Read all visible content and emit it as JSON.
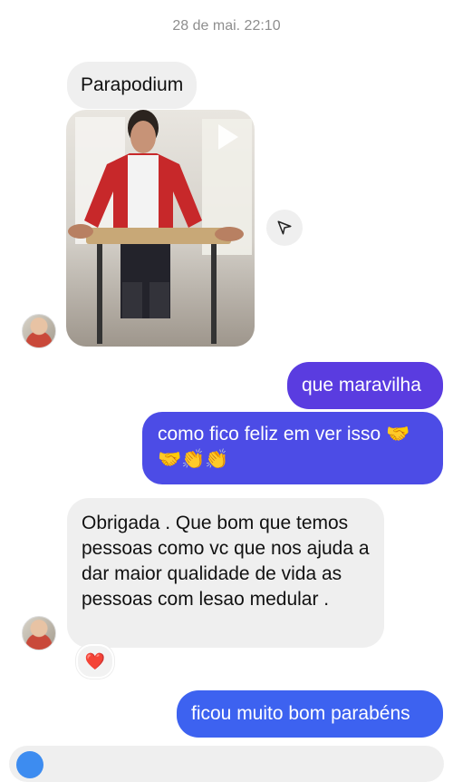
{
  "header": {
    "timestamp": "28 de mai. 22:10"
  },
  "messages": [
    {
      "side": "incoming",
      "text": "Parapodium"
    },
    {
      "side": "incoming",
      "type": "video",
      "media_label": "video-thumbnail"
    },
    {
      "side": "outgoing",
      "text": "que maravilha"
    },
    {
      "side": "outgoing",
      "text_line1": "como fico feliz em ver isso 🤝",
      "text_line2": "🤝👏👏"
    },
    {
      "side": "incoming",
      "text": "Obrigada . Que bom que temos pessoas como vc que nos ajuda a dar maior qualidade de vida as pessoas com lesao medular .",
      "reaction": "❤️"
    },
    {
      "side": "outgoing",
      "text": "ficou muito bom parabéns"
    }
  ],
  "colors": {
    "incoming_bubble": "#efefef",
    "outgoing_purple": "#5a3ce0",
    "outgoing_indigo": "#4c4ce6",
    "outgoing_blue": "#3d62f0",
    "timestamp": "#8e8e8e"
  },
  "icons": {
    "play": "play-icon",
    "share": "paper-plane-icon",
    "heart": "heart-icon"
  }
}
